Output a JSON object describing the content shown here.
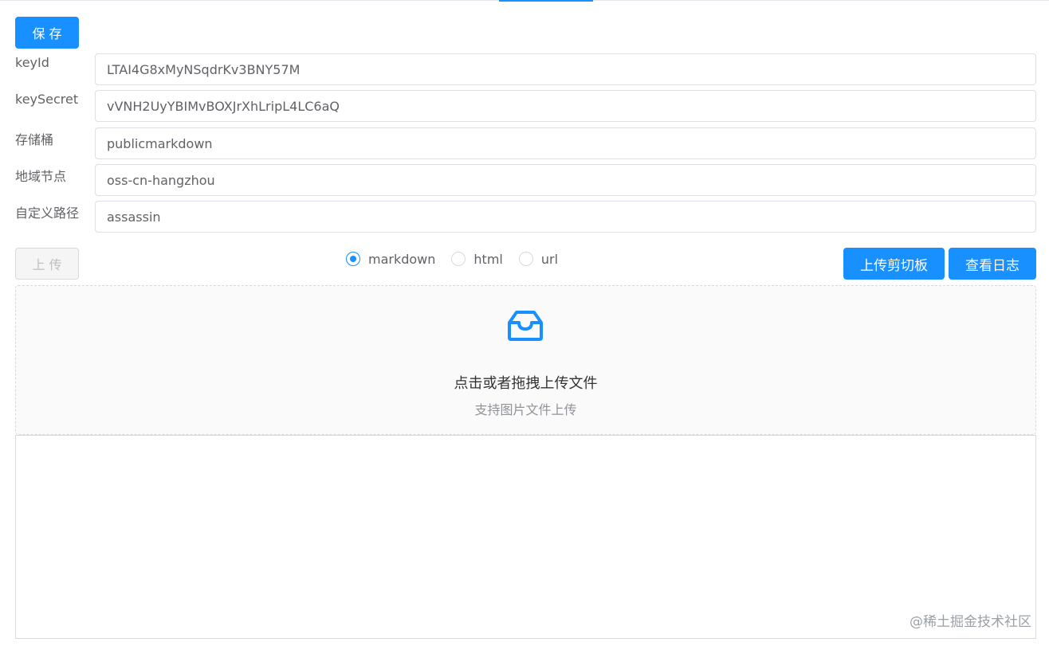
{
  "toolbar": {
    "save_label": "保 存"
  },
  "form": {
    "fields": [
      {
        "label": "keyId",
        "value": "LTAI4G8xMyNSqdrKv3BNY57M"
      },
      {
        "label": "keySecret",
        "value": "vVNH2UyYBIMvBOXJrXhLripL4LC6aQ"
      },
      {
        "label": "存储桶",
        "value": "publicmarkdown"
      },
      {
        "label": "地域节点",
        "value": "oss-cn-hangzhou"
      },
      {
        "label": "自定义路径",
        "value": "assassin"
      }
    ]
  },
  "actions": {
    "upload_label": "上 传",
    "clipboard_label": "上传剪切板",
    "log_label": "查看日志"
  },
  "format": {
    "selected": "markdown",
    "options": [
      {
        "label": "markdown"
      },
      {
        "label": "html"
      },
      {
        "label": "url"
      }
    ]
  },
  "dropzone": {
    "main_text": "点击或者拖拽上传文件",
    "sub_text": "支持图片文件上传",
    "icon": "inbox-icon"
  },
  "output": {
    "value": ""
  },
  "watermark": "@稀土掘金技术社区",
  "colors": {
    "primary": "#1890ff",
    "border": "#dcdfe6"
  }
}
